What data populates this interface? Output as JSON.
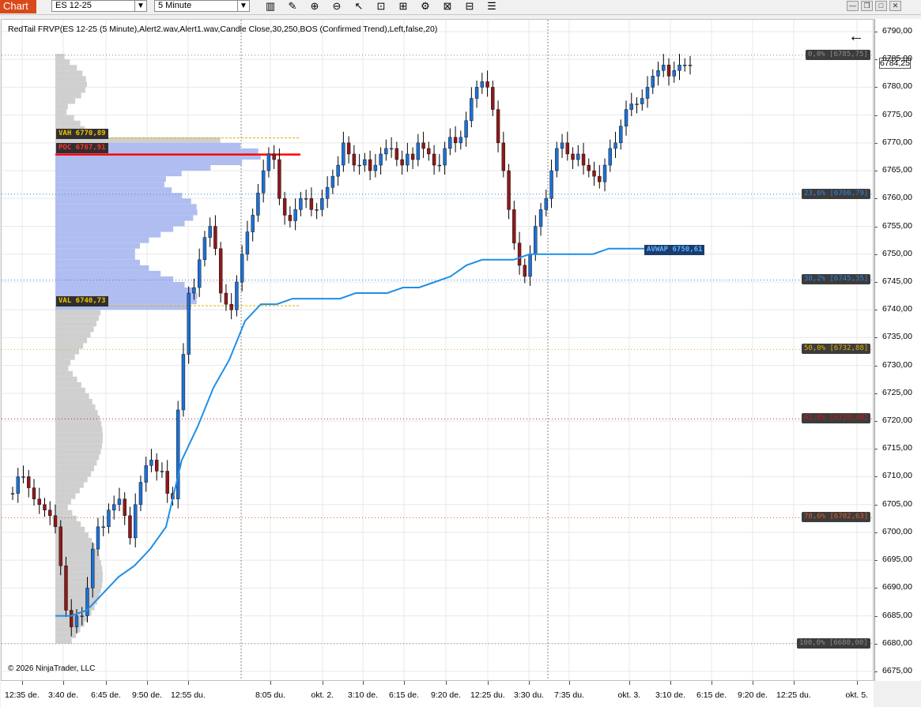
{
  "toolbar": {
    "chart_tab": "Chart",
    "instrument": "ES 12-25",
    "interval": "5 Minute",
    "icons": [
      "bar-type-icon",
      "draw-pencil-icon",
      "zoom-in-icon",
      "zoom-out-icon",
      "pointer-icon",
      "data-box-icon",
      "chart-trader-icon",
      "properties-icon",
      "strategies-icon",
      "templates-icon",
      "list-icon"
    ],
    "window_buttons": [
      "minimize-icon",
      "restore-icon",
      "close-icon"
    ]
  },
  "indicator_label": "RedTail FRVP(ES 12-25 (5 Minute),Alert2.wav,Alert1.wav,Candle Close,30,250,BOS (Confirmed Trend),Left,false,20)",
  "copyright": "© 2026 NinjaTrader, LLC",
  "last_price": "6784,25",
  "price_axis": [
    "6790,00",
    "6785,00",
    "6780,00",
    "6775,00",
    "6770,00",
    "6765,00",
    "6760,00",
    "6755,00",
    "6750,00",
    "6745,00",
    "6740,00",
    "6735,00",
    "6730,00",
    "6725,00",
    "6720,00",
    "6715,00",
    "6710,00",
    "6705,00",
    "6700,00",
    "6695,00",
    "6690,00",
    "6685,00",
    "6680,00",
    "6675,00"
  ],
  "time_axis": [
    "12:35 de.",
    "3:40 de.",
    "6:45 de.",
    "9:50 de.",
    "12:55 du.",
    "8:05 du.",
    "okt. 2.",
    "3:10 de.",
    "6:15 de.",
    "9:20 de.",
    "12:25 du.",
    "3:30 du.",
    "7:35 du.",
    "okt. 3.",
    "3:10 de.",
    "6:15 de.",
    "9:20 de.",
    "12:25 du.",
    "okt. 5."
  ],
  "fib_levels": [
    {
      "label": "0,0% [6785,75]",
      "price": 6785.75,
      "color": "#8a8a8a"
    },
    {
      "label": "23,6% [6760,79]",
      "price": 6760.79,
      "color": "#2f86e0"
    },
    {
      "label": "38,2% [6745,35]",
      "price": 6745.35,
      "color": "#2f86e0"
    },
    {
      "label": "50,0% [6732,88]",
      "price": 6732.88,
      "color": "#e0b000"
    },
    {
      "label": "61,8% [6720,40]",
      "price": 6720.4,
      "color": "#d01818"
    },
    {
      "label": "78,6% [6702,63]",
      "price": 6702.63,
      "color": "#e05a28"
    },
    {
      "label": "100,0% [6680,00]",
      "price": 6680.0,
      "color": "#8a8a8a"
    }
  ],
  "volume_profile": {
    "vah_label": "VAH 6770,89",
    "vah_price": 6770.89,
    "poc_label": "POC 6767,91",
    "poc_price": 6767.91,
    "val_label": "VAL 6740,73",
    "val_price": 6740.73,
    "value_area_color": "#b0bdf0",
    "outside_color": "#cfcfcf",
    "poc_color": "#ff0000",
    "vah_color": "#e0b000",
    "val_color": "#e0b000"
  },
  "avwap": {
    "label": "AVWAP 6750,61",
    "price": 6750.61,
    "color": "#1e8fe8"
  },
  "colors": {
    "up_candle": "#1f6fd0",
    "down_candle": "#8b1a1a",
    "wick": "#000000",
    "grid": "#e8e8e8"
  },
  "chart_data": {
    "type": "line",
    "title": "ES 12-25 (5 Minute)",
    "ylim": [
      6673.5,
      6792
    ],
    "y_ticks": [
      6790,
      6785,
      6780,
      6775,
      6770,
      6765,
      6760,
      6755,
      6750,
      6745,
      6740,
      6735,
      6730,
      6725,
      6720,
      6715,
      6710,
      6705,
      6700,
      6695,
      6690,
      6685,
      6680,
      6675
    ],
    "x_tick_labels": [
      "12:35 de.",
      "3:40 de.",
      "6:45 de.",
      "9:50 de.",
      "12:55 du.",
      "8:05 du.",
      "okt. 2.",
      "3:10 de.",
      "6:15 de.",
      "9:20 de.",
      "12:25 du.",
      "3:30 du.",
      "7:35 du.",
      "okt. 3.",
      "3:10 de.",
      "6:15 de.",
      "9:20 de.",
      "12:25 du.",
      "okt. 5."
    ],
    "series": [
      {
        "values": [
          6707,
          6710,
          6710,
          6708,
          6706,
          6705,
          6704,
          6703,
          6701,
          6694,
          6686,
          6683,
          6685,
          6685,
          6690,
          6697,
          6701,
          6701,
          6704,
          6705,
          6706,
          6703,
          6699,
          6705,
          6709,
          6712,
          6713,
          6711,
          6711,
          6707,
          6706,
          6722,
          6732,
          6743,
          6744,
          6749,
          6753,
          6755,
          6751,
          6743,
          6741,
          6740,
          6745,
          6750,
          6754,
          6757,
          6761,
          6765,
          6768,
          6767,
          6760,
          6757,
          6756,
          6758,
          6760,
          6760,
          6758,
          6758,
          6760,
          6762,
          6764,
          6766,
          6770,
          6768,
          6766,
          6766,
          6767,
          6765,
          6766,
          6768,
          6769,
          6769,
          6767,
          6766,
          6768,
          6767,
          6770,
          6769,
          6768,
          6766,
          6766,
          6769,
          6771,
          6770,
          6771,
          6774,
          6778,
          6780,
          6781,
          6780,
          6776,
          6770,
          6765,
          6758,
          6752,
          6748,
          6746,
          6750,
          6755,
          6758,
          6760,
          6765,
          6769,
          6770,
          6768,
          6767,
          6768,
          6766,
          6765,
          6764,
          6763,
          6766,
          6769,
          6770,
          6773,
          6776,
          6777,
          6777,
          6778,
          6780,
          6782,
          6783,
          6784,
          6782,
          6783,
          6784,
          6784,
          6784
        ]
      },
      {
        "values": [
          6685,
          6685,
          6686,
          6689,
          6692,
          6694,
          6697,
          6701,
          6713,
          6719,
          6726,
          6731,
          6738,
          6741,
          6741,
          6742,
          6742,
          6742,
          6742,
          6743,
          6743,
          6743,
          6744,
          6744,
          6745,
          6746,
          6748,
          6749,
          6749,
          6749,
          6750,
          6750,
          6750,
          6750,
          6750,
          6751,
          6751,
          6751,
          6751,
          6751
        ]
      }
    ],
    "series_units": "price"
  }
}
